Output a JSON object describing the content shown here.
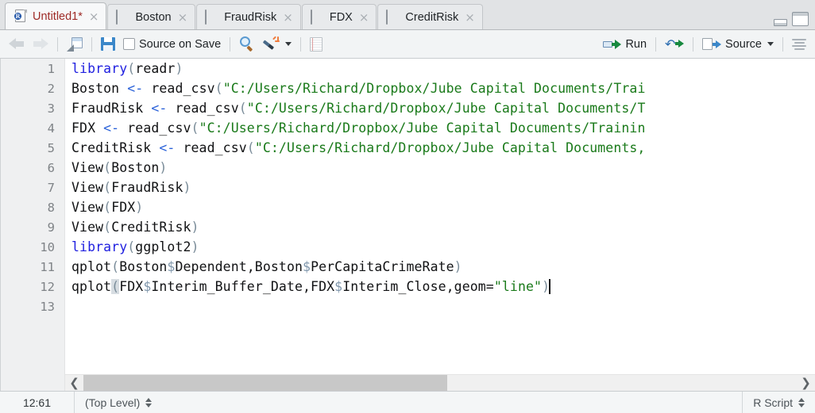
{
  "window": {
    "minimize_label": "minimize",
    "maximize_label": "maximize"
  },
  "tabs": [
    {
      "label": "Untitled1*",
      "icon": "r-script-file-icon",
      "active": true,
      "close": "×"
    },
    {
      "label": "Boston",
      "icon": "data-grid-icon",
      "active": false,
      "close": "×"
    },
    {
      "label": "FraudRisk",
      "icon": "data-grid-icon",
      "active": false,
      "close": "×"
    },
    {
      "label": "FDX",
      "icon": "data-grid-icon",
      "active": false,
      "close": "×"
    },
    {
      "label": "CreditRisk",
      "icon": "data-grid-icon",
      "active": false,
      "close": "×"
    }
  ],
  "toolbar": {
    "back_icon": "arrow-left-icon",
    "forward_icon": "arrow-right-icon",
    "popout_icon": "show-in-new-window-icon",
    "save_icon": "save-icon",
    "source_on_save_label": "Source on Save",
    "find_icon": "magnifier-icon",
    "magic_icon": "magic-wand-icon",
    "compile_report_icon": "notebook-icon",
    "run_label": "Run",
    "run_icon": "run-icon",
    "rerun_icon": "rerun-previous-icon",
    "source_label": "Source",
    "source_icon": "source-icon",
    "outline_icon": "document-outline-icon"
  },
  "editor": {
    "lines": [
      {
        "num": "1",
        "tokens": [
          {
            "t": "library",
            "c": "kw"
          },
          {
            "t": "(",
            "c": "paren"
          },
          {
            "t": "readr",
            "c": "op"
          },
          {
            "t": ")",
            "c": "paren"
          }
        ]
      },
      {
        "num": "2",
        "tokens": [
          {
            "t": "Boston ",
            "c": "op"
          },
          {
            "t": "<-",
            "c": "assign"
          },
          {
            "t": " read_csv",
            "c": "op"
          },
          {
            "t": "(",
            "c": "paren"
          },
          {
            "t": "\"C:/Users/Richard/Dropbox/Jube Capital Documents/Trai",
            "c": "str"
          }
        ]
      },
      {
        "num": "3",
        "tokens": [
          {
            "t": "FraudRisk ",
            "c": "op"
          },
          {
            "t": "<-",
            "c": "assign"
          },
          {
            "t": " read_csv",
            "c": "op"
          },
          {
            "t": "(",
            "c": "paren"
          },
          {
            "t": "\"C:/Users/Richard/Dropbox/Jube Capital Documents/T",
            "c": "str"
          }
        ]
      },
      {
        "num": "4",
        "tokens": [
          {
            "t": "FDX ",
            "c": "op"
          },
          {
            "t": "<-",
            "c": "assign"
          },
          {
            "t": " read_csv",
            "c": "op"
          },
          {
            "t": "(",
            "c": "paren"
          },
          {
            "t": "\"C:/Users/Richard/Dropbox/Jube Capital Documents/Trainin",
            "c": "str"
          }
        ]
      },
      {
        "num": "5",
        "tokens": [
          {
            "t": "CreditRisk ",
            "c": "op"
          },
          {
            "t": "<-",
            "c": "assign"
          },
          {
            "t": " read_csv",
            "c": "op"
          },
          {
            "t": "(",
            "c": "paren"
          },
          {
            "t": "\"C:/Users/Richard/Dropbox/Jube Capital Documents,",
            "c": "str"
          }
        ]
      },
      {
        "num": "6",
        "tokens": [
          {
            "t": "View",
            "c": "op"
          },
          {
            "t": "(",
            "c": "paren"
          },
          {
            "t": "Boston",
            "c": "op"
          },
          {
            "t": ")",
            "c": "paren"
          }
        ]
      },
      {
        "num": "7",
        "tokens": [
          {
            "t": "View",
            "c": "op"
          },
          {
            "t": "(",
            "c": "paren"
          },
          {
            "t": "FraudRisk",
            "c": "op"
          },
          {
            "t": ")",
            "c": "paren"
          }
        ]
      },
      {
        "num": "8",
        "tokens": [
          {
            "t": "View",
            "c": "op"
          },
          {
            "t": "(",
            "c": "paren"
          },
          {
            "t": "FDX",
            "c": "op"
          },
          {
            "t": ")",
            "c": "paren"
          }
        ]
      },
      {
        "num": "9",
        "tokens": [
          {
            "t": "View",
            "c": "op"
          },
          {
            "t": "(",
            "c": "paren"
          },
          {
            "t": "CreditRisk",
            "c": "op"
          },
          {
            "t": ")",
            "c": "paren"
          }
        ]
      },
      {
        "num": "10",
        "tokens": [
          {
            "t": "library",
            "c": "kw"
          },
          {
            "t": "(",
            "c": "paren"
          },
          {
            "t": "ggplot2",
            "c": "op"
          },
          {
            "t": ")",
            "c": "paren"
          }
        ]
      },
      {
        "num": "11",
        "tokens": [
          {
            "t": "qplot",
            "c": "op"
          },
          {
            "t": "(",
            "c": "paren"
          },
          {
            "t": "Boston",
            "c": "op"
          },
          {
            "t": "$",
            "c": "dollar"
          },
          {
            "t": "Dependent,Boston",
            "c": "op"
          },
          {
            "t": "$",
            "c": "dollar"
          },
          {
            "t": "PerCapitaCrimeRate",
            "c": "op"
          },
          {
            "t": ")",
            "c": "paren"
          }
        ]
      },
      {
        "num": "12",
        "tokens": [
          {
            "t": "qplot",
            "c": "op"
          },
          {
            "t": "(",
            "c": "paren hl"
          },
          {
            "t": "FDX",
            "c": "op"
          },
          {
            "t": "$",
            "c": "dollar"
          },
          {
            "t": "Interim_Buffer_Date,FDX",
            "c": "op"
          },
          {
            "t": "$",
            "c": "dollar"
          },
          {
            "t": "Interim_Close,geom=",
            "c": "op"
          },
          {
            "t": "\"line\"",
            "c": "str"
          },
          {
            "t": ")",
            "c": "paren"
          }
        ],
        "cursor": true
      },
      {
        "num": "13",
        "tokens": []
      }
    ],
    "scrollbar": {
      "left_arrow": "❮",
      "right_arrow": "❯"
    }
  },
  "statusbar": {
    "position": "12:61",
    "scope": "(Top Level)",
    "file_type": "R Script"
  }
}
